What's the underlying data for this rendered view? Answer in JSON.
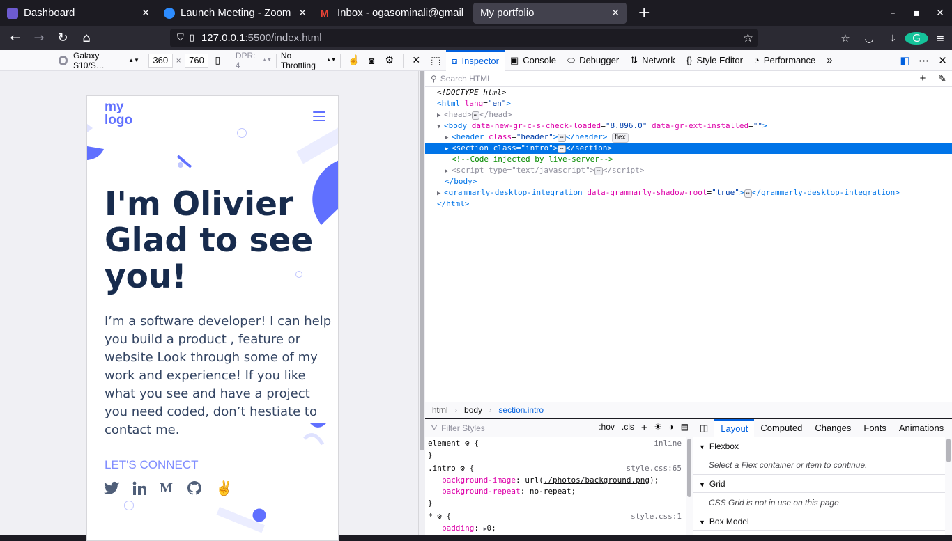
{
  "browser": {
    "tabs": [
      {
        "label": "Dashboard",
        "color": "#6d5bd0"
      },
      {
        "label": "Launch Meeting - Zoom",
        "color": "#2d8cff"
      },
      {
        "label": "Inbox - ogasominali@gmail.com",
        "color": "#ea4335"
      },
      {
        "label": "My portfolio",
        "color": "#42414d"
      }
    ],
    "url_host": "127.0.0.1",
    "url_rest": ":5500/index.html"
  },
  "rdm": {
    "device": "Galaxy S10/S…",
    "width": "360",
    "times": "×",
    "height": "760",
    "dpr": "DPR: 4",
    "throttling": "No Throttling"
  },
  "page": {
    "logo_line1": "my",
    "logo_line2": "logo",
    "headline": "I'm Olivier Glad to see you!",
    "intro": "I’m a software developer! I can help you build a product , feature or website Look through some of my work and experience! If you like what you see and have a project you need coded, don’t hestiate to contact me.",
    "connect": "LET'S CONNECT",
    "socials": [
      "twitter-icon",
      "linkedin-icon",
      "medium-icon",
      "github-icon",
      "angellist-icon"
    ]
  },
  "devtools": {
    "tabs": [
      "Inspector",
      "Console",
      "Debugger",
      "Network",
      "Style Editor",
      "Performance"
    ],
    "search_placeholder": "Search HTML",
    "markup": {
      "doctype": "<!DOCTYPE html>",
      "html_open": "<html lang=\"en\">",
      "head": "head",
      "body_attr1_name": "data-new-gr-c-s-check-loaded",
      "body_attr1_val": "8.896.0",
      "body_attr2_name": "data-gr-ext-installed",
      "header_class": "header",
      "flex_badge": "flex",
      "section_class": "intro",
      "comment": "<!--Code injected by live-server-->",
      "script_type": "text/javascript",
      "body_close": "</body>",
      "grammarly_tag": "grammarly-desktop-integration",
      "grammarly_attr": "data-grammarly-shadow-root",
      "grammarly_val": "true",
      "html_close": "</html>"
    },
    "breadcrumbs": [
      "html",
      "body",
      "section.intro"
    ],
    "filter_placeholder": "Filter Styles",
    "hov": ":hov",
    "cls": ".cls",
    "rules": {
      "element_selector": "element",
      "element_src": "inline",
      "intro_selector": ".intro",
      "intro_src": "style.css:65",
      "bg_image_prop": "background-image",
      "bg_image_url": "./photos/background.png",
      "bg_repeat_prop": "background-repeat",
      "bg_repeat_val": "no-repeat",
      "star_selector": "*",
      "star_src": "style.css:1",
      "padding_prop": "padding",
      "padding_val": "0"
    },
    "side_tabs": [
      "Layout",
      "Computed",
      "Changes",
      "Fonts",
      "Animations"
    ],
    "layout": {
      "flexbox": "Flexbox",
      "flexbox_msg": "Select a Flex container or item to continue.",
      "grid": "Grid",
      "grid_msg": "CSS Grid is not in use on this page",
      "box_model": "Box Model"
    }
  }
}
